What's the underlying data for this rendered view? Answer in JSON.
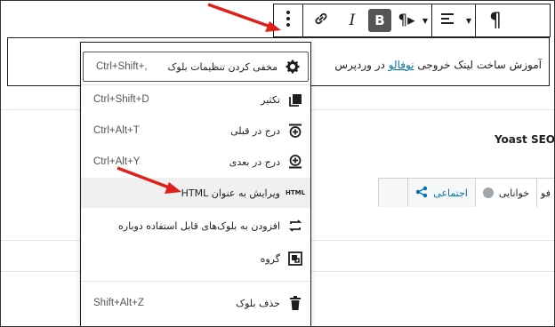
{
  "editor": {
    "block_text_before": "آموزش ساخت لینک خروجی",
    "block_link": "نوفالو",
    "block_text_after": "در وردپرس",
    "yoast_title": "Yoast SEO",
    "tabs": [
      {
        "label": "خوانایی"
      },
      {
        "label": "اجتماعی"
      }
    ],
    "tab_partial": "فو"
  },
  "toolbar": {
    "icons": [
      "paragraph-icon",
      "align-icon",
      "text-direction-icon",
      "bold-icon",
      "italic-icon",
      "link-icon",
      "more-options-icon"
    ]
  },
  "menu": {
    "items": [
      {
        "label": "مخفی کردن تنظیمات بلوک",
        "shortcut": "Ctrl+Shift+,",
        "icon": "gear-icon"
      },
      {
        "label": "تکثیر",
        "shortcut": "Ctrl+Shift+D",
        "icon": "duplicate-icon"
      },
      {
        "label": "درج در قبلی",
        "shortcut": "Ctrl+Alt+T",
        "icon": "insert-before-icon"
      },
      {
        "label": "درج در بعدی",
        "shortcut": "Ctrl+Alt+Y",
        "icon": "insert-after-icon"
      },
      {
        "label": "ویرایش به عنوان HTML",
        "shortcut": "",
        "icon": "html-icon"
      },
      {
        "label": "افزودن به بلوک‌های قابل استفاده دوباره",
        "shortcut": "",
        "icon": "reusable-icon"
      },
      {
        "label": "گروه",
        "shortcut": "",
        "icon": "group-icon"
      },
      {
        "label": "حذف بلوک",
        "shortcut": "Shift+Alt+Z",
        "icon": "trash-icon"
      }
    ]
  },
  "colors": {
    "arrow": "#e0201b",
    "link": "#0073aa",
    "bold_bg": "#555555"
  }
}
